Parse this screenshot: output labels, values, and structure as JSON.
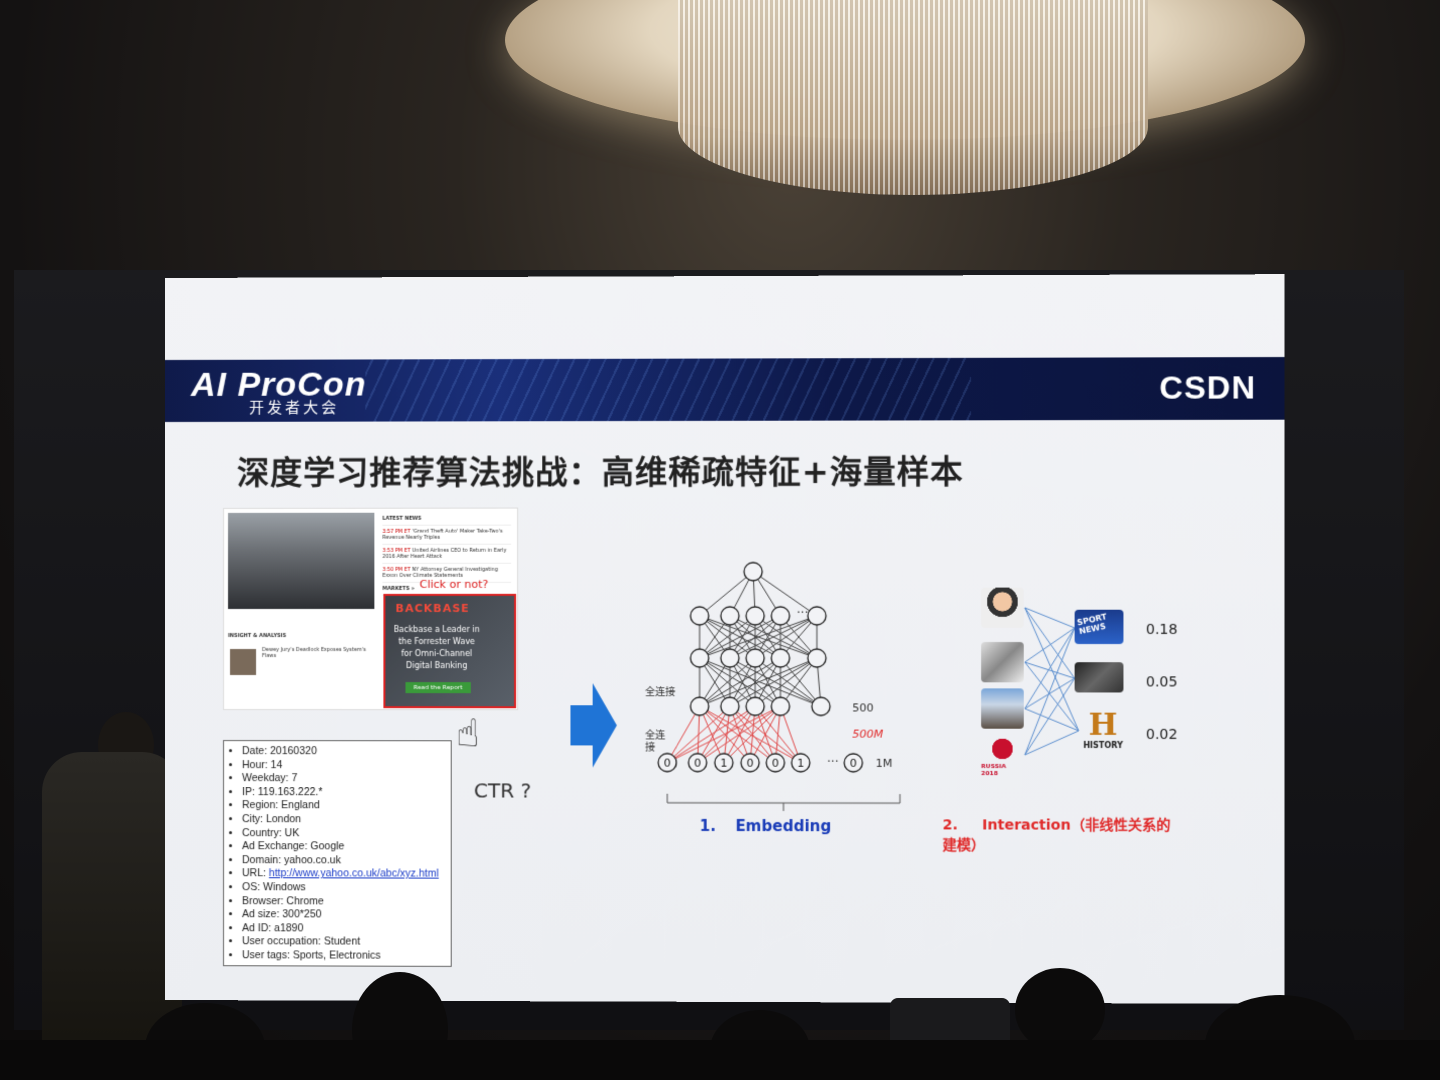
{
  "slide": {
    "logo_main": "AI ProCon",
    "logo_sub": "开发者大会",
    "brand_right": "CSDN",
    "title": "深度学习推荐算法挑战：高维稀疏特征+海量样本",
    "thumbnail": {
      "news_header": "LATEST NEWS",
      "news_items": [
        {
          "time": "3:57 PM ET",
          "text": "'Grand Theft Auto' Maker Take-Two's Revenue Nearly Triples"
        },
        {
          "time": "3:53 PM ET",
          "text": "United Airlines CEO to Return in Early 2016 After Heart Attack"
        },
        {
          "time": "3:50 PM ET",
          "text": "NY Attorney General Investigating Exxon Over Climate Statements"
        }
      ],
      "markets": "MARKETS »",
      "insight_header": "INSIGHT & ANALYSIS",
      "insight_text": "Dewey Jury's Deadlock Exposes System's Flaws",
      "ad_brand": "BACKBASE",
      "ad_text": "Backbase a Leader in the Forrester Wave for Omni-Channel Digital Banking",
      "ad_button": "Read the Report"
    },
    "click_label": "Click or not?",
    "ctr_label": "CTR ?",
    "features": [
      "Date: 20160320",
      "Hour: 14",
      "Weekday: 7",
      "IP: 119.163.222.*",
      "Region: England",
      "City: London",
      "Country: UK",
      "Ad Exchange: Google",
      "Domain: yahoo.co.uk",
      "URL: ",
      "OS: Windows",
      "Browser: Chrome",
      "Ad size: 300*250",
      "Ad ID: a1890",
      "User occupation: Student",
      "User tags: Sports, Electronics"
    ],
    "url_link": "http://www.yahoo.co.uk/abc/xyz.html",
    "embedding": {
      "fc_label_1": "全连接",
      "fc_label_2": "全连接",
      "layer_500": "500",
      "layer_500m": "500M",
      "layer_1m": "1M",
      "inputs": [
        "0",
        "0",
        "1",
        "0",
        "0",
        "1",
        "0"
      ],
      "dots": "···",
      "label_num": "1.",
      "label": "Embedding"
    },
    "interaction": {
      "label_num": "2.",
      "label": "Interaction（非线性关系的建模）",
      "scores": [
        "0.18",
        "0.05",
        "0.02"
      ],
      "item_labels": [
        "SPORT NEWS",
        "HISTORY"
      ],
      "worldcup_text": "RUSSIA 2018"
    }
  },
  "colors": {
    "header_navy": "#0f1a4a",
    "title_text": "#222222",
    "accent_red": "#e02a2a",
    "accent_blue": "#1a3cb8",
    "arrow_blue": "#1f74d6"
  }
}
